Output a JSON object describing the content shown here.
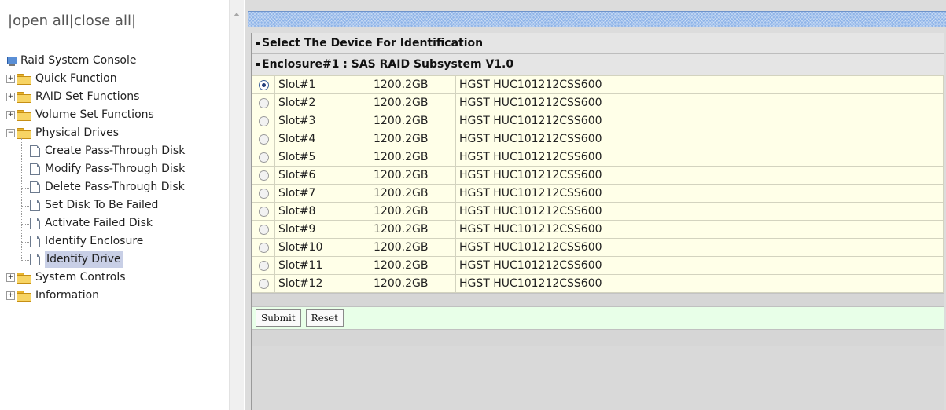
{
  "nav": {
    "open_close": {
      "sep1": "|",
      "open": "open all",
      "sep2": "|",
      "close": "close all",
      "sep3": "|"
    },
    "root_label": "Raid System Console",
    "items": [
      {
        "label": "Quick Function",
        "expander": "+"
      },
      {
        "label": "RAID Set Functions",
        "expander": "+"
      },
      {
        "label": "Volume Set Functions",
        "expander": "+"
      },
      {
        "label": "Physical Drives",
        "expander": "−"
      },
      {
        "label": "System Controls",
        "expander": "+"
      },
      {
        "label": "Information",
        "expander": "+"
      }
    ],
    "physical_drives_children": [
      "Create Pass-Through Disk",
      "Modify Pass-Through Disk",
      "Delete Pass-Through Disk",
      "Set Disk To Be Failed",
      "Activate Failed Disk",
      "Identify Enclosure",
      "Identify Drive"
    ],
    "selected_item": "Identify Drive"
  },
  "main": {
    "title": "Select The Device For Identification",
    "enclosure": "Enclosure#1 : SAS RAID Subsystem V1.0",
    "drives": [
      {
        "slot": "Slot#1",
        "capacity": "1200.2GB",
        "model": "HGST HUC101212CSS600",
        "selected": true
      },
      {
        "slot": "Slot#2",
        "capacity": "1200.2GB",
        "model": "HGST HUC101212CSS600",
        "selected": false
      },
      {
        "slot": "Slot#3",
        "capacity": "1200.2GB",
        "model": "HGST HUC101212CSS600",
        "selected": false
      },
      {
        "slot": "Slot#4",
        "capacity": "1200.2GB",
        "model": "HGST HUC101212CSS600",
        "selected": false
      },
      {
        "slot": "Slot#5",
        "capacity": "1200.2GB",
        "model": "HGST HUC101212CSS600",
        "selected": false
      },
      {
        "slot": "Slot#6",
        "capacity": "1200.2GB",
        "model": "HGST HUC101212CSS600",
        "selected": false
      },
      {
        "slot": "Slot#7",
        "capacity": "1200.2GB",
        "model": "HGST HUC101212CSS600",
        "selected": false
      },
      {
        "slot": "Slot#8",
        "capacity": "1200.2GB",
        "model": "HGST HUC101212CSS600",
        "selected": false
      },
      {
        "slot": "Slot#9",
        "capacity": "1200.2GB",
        "model": "HGST HUC101212CSS600",
        "selected": false
      },
      {
        "slot": "Slot#10",
        "capacity": "1200.2GB",
        "model": "HGST HUC101212CSS600",
        "selected": false
      },
      {
        "slot": "Slot#11",
        "capacity": "1200.2GB",
        "model": "HGST HUC101212CSS600",
        "selected": false
      },
      {
        "slot": "Slot#12",
        "capacity": "1200.2GB",
        "model": "HGST HUC101212CSS600",
        "selected": false
      }
    ],
    "buttons": {
      "submit": "Submit",
      "reset": "Reset"
    }
  },
  "colors": {
    "table_row": "#ffffe8",
    "button_bar": "#e8ffe8",
    "header_bar": "#8fb4e8",
    "selection": "#c8cfe6"
  }
}
